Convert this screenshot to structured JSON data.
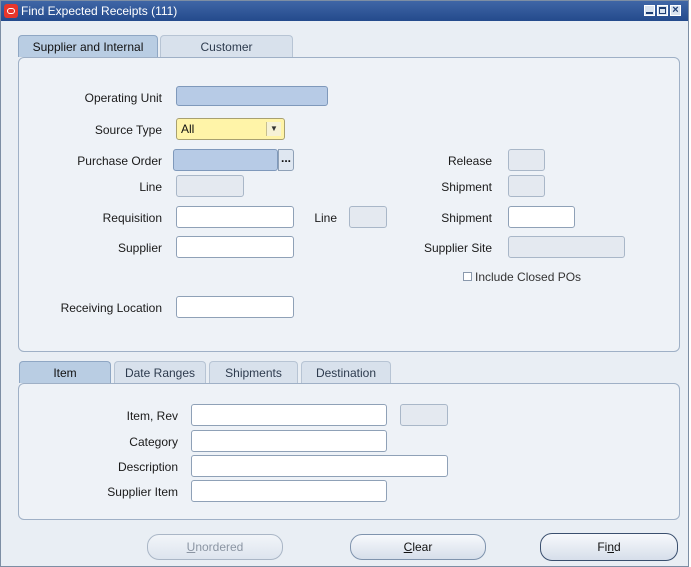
{
  "window": {
    "title": "Find Expected Receipts (111)"
  },
  "top_tabs": [
    "Supplier and Internal",
    "Customer"
  ],
  "form": {
    "operating_unit": {
      "label": "Operating Unit",
      "value": ""
    },
    "source_type": {
      "label": "Source Type",
      "value": "All"
    },
    "purchase_order": {
      "label": "Purchase Order",
      "value": "",
      "lov": "..."
    },
    "po_line": {
      "label": "Line",
      "value": ""
    },
    "release": {
      "label": "Release",
      "value": ""
    },
    "po_shipment": {
      "label": "Shipment",
      "value": ""
    },
    "requisition": {
      "label": "Requisition",
      "value": ""
    },
    "req_line": {
      "label": "Line",
      "value": ""
    },
    "req_shipment": {
      "label": "Shipment",
      "value": ""
    },
    "supplier": {
      "label": "Supplier",
      "value": ""
    },
    "supplier_site": {
      "label": "Supplier Site",
      "value": ""
    },
    "include_closed_pos": {
      "label": "Include Closed POs",
      "checked": false
    },
    "receiving_location": {
      "label": "Receiving Location",
      "value": ""
    }
  },
  "bottom_tabs": [
    "Item",
    "Date Ranges",
    "Shipments",
    "Destination"
  ],
  "item_section": {
    "item_rev": {
      "label": "Item, Rev",
      "value": "",
      "rev": ""
    },
    "category": {
      "label": "Category",
      "value": ""
    },
    "description": {
      "label": "Description",
      "value": ""
    },
    "supplier_item": {
      "label": "Supplier Item",
      "value": ""
    }
  },
  "buttons": {
    "unordered": {
      "pre": "",
      "key": "U",
      "post": "nordered"
    },
    "clear": {
      "pre": "",
      "key": "C",
      "post": "lear"
    },
    "find": {
      "pre": "Fi",
      "key": "n",
      "post": "d"
    }
  }
}
